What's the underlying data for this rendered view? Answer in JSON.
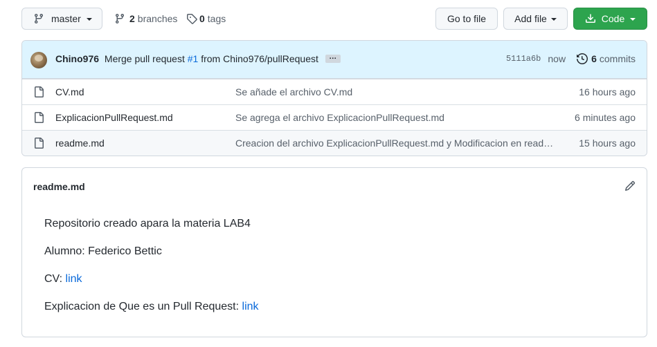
{
  "toolbar": {
    "branch_name": "master",
    "branches_count": "2",
    "branches_label": "branches",
    "tags_count": "0",
    "tags_label": "tags",
    "goto_file_label": "Go to file",
    "add_file_label": "Add file",
    "code_label": "Code"
  },
  "commit": {
    "author": "Chino976",
    "message_prefix": "Merge pull request",
    "pr_number": "#1",
    "message_suffix": "from Chino976/pullRequest",
    "ellipsis": "…",
    "sha": "5111a6b",
    "time": "now",
    "commits_count": "6",
    "commits_label": "commits"
  },
  "files": [
    {
      "name": "CV.md",
      "message": "Se añade el archivo CV.md",
      "time": "16 hours ago"
    },
    {
      "name": "ExplicacionPullRequest.md",
      "message": "Se agrega el archivo ExplicacionPullRequest.md",
      "time": "6 minutes ago"
    },
    {
      "name": "readme.md",
      "message": "Creacion del archivo ExplicacionPullRequest.md y Modificacion en readme.md",
      "time": "15 hours ago"
    }
  ],
  "readme": {
    "title": "readme.md",
    "line1": "Repositorio creado apara la materia LAB4",
    "line2": "Alumno: Federico Bettic",
    "line3_prefix": "CV:",
    "line3_link": "link",
    "line4_prefix": "Explicacion de Que es un Pull Request:",
    "line4_link": "link"
  },
  "colors": {
    "accent_blue": "#0969da",
    "code_button_green": "#2da44e",
    "commit_bar_bg": "#ddf4ff",
    "border": "#d0d7de"
  },
  "icons": {
    "branch": "git-branch-icon",
    "tag": "tag-icon",
    "download": "download-icon",
    "history": "history-icon",
    "file": "file-icon",
    "pencil": "pencil-icon"
  }
}
